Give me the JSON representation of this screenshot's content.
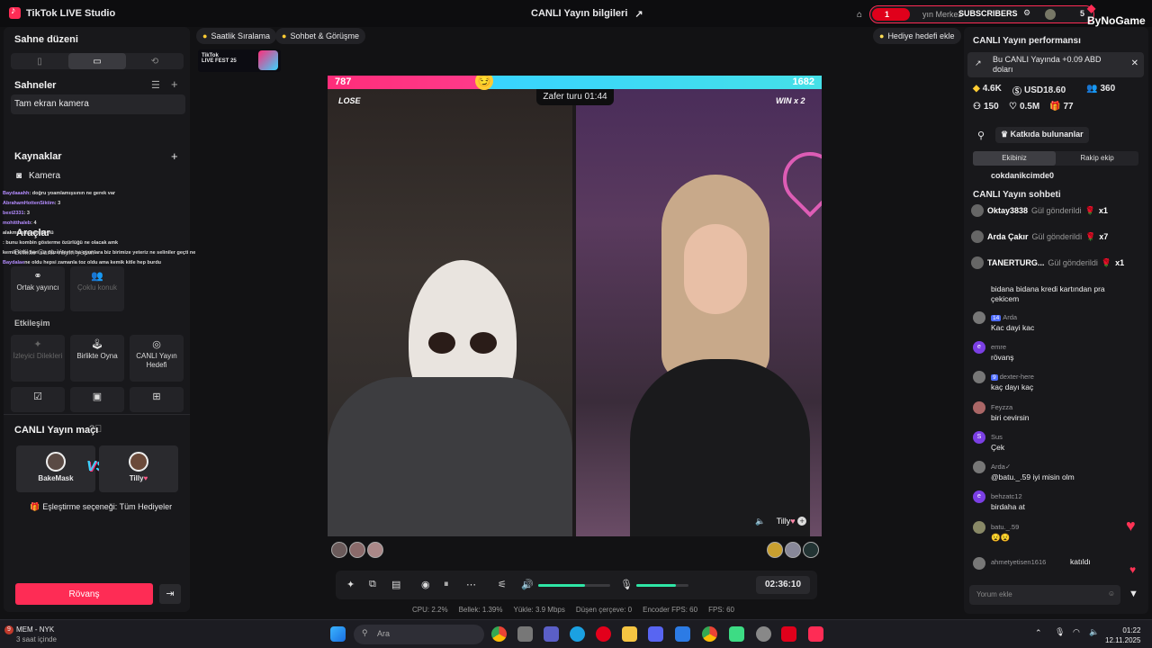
{
  "titlebar": {
    "app_name": "TikTok LIVE Studio",
    "live_info": "CANLI Yayın bilgileri",
    "sub_count_left": "1",
    "center_text": "yın Merkez",
    "subscribers": "SUBSCRIBERS",
    "sub_count_right": "5",
    "brand": "ByNoGame"
  },
  "left": {
    "scene_layout_title": "Sahne düzeni",
    "scenes_title": "Sahneler",
    "scene_item": "Tam ekran kamera",
    "sources_title": "Kaynaklar",
    "camera_label": "Kamera",
    "tools_title": "Araçlar",
    "tools_sub": "Birlikte Canlı Yayın yapın",
    "tiles": [
      {
        "label": "Ortak yayıncı"
      },
      {
        "label": "Çoklu konuk"
      }
    ],
    "interaction_title": "Etkileşim",
    "interaction_tiles": [
      {
        "label": "İzleyici Dilekleri"
      },
      {
        "label": "Birlikte Oyna"
      },
      {
        "label": "CANLI Yayın Hedefi"
      }
    ],
    "match_title": "CANLI Yayın maçı",
    "match_left": "BakeMask",
    "match_right": "Tilly",
    "match_vs": "VS",
    "pairing": "Eşleştirme seçeneği: Tüm Hediyeler",
    "rematch": "Rövanş"
  },
  "overlay_chat": [
    {
      "user": "Baydaaahh",
      "text": ": doğru yoamlamışsının ne gerek var"
    },
    {
      "user": "AbrahamHottenSiktim",
      "text": ": 3"
    },
    {
      "user": "bext2331",
      "text": ": 3"
    },
    {
      "user": "mohitthaleb",
      "text": ": 4"
    },
    {
      "user": "",
      "text": "alakmsın la sen köylü"
    },
    {
      "user": "",
      "text": ": bunu kombin gösterme özürlüğü ne olacak amk"
    },
    {
      "user": "",
      "text": "kemik kitle bari siz düzenleyin bu oyunlara biz birimize yeteriz ne seliniler geçti ne"
    },
    {
      "user": "Baydalae",
      "text": "ne oldu hepsi zamanla toz oldu ama kemik kitle hep burdu"
    }
  ],
  "center": {
    "chip_hourly": "Saatlik Sıralama",
    "chip_chat": "Sohbet & Görüşme",
    "chip_gift_goal": "Hediye hedefi ekle",
    "livefest_line1": "TikTok",
    "livefest_line2": "LIVE FEST 25",
    "score_left": "787",
    "score_right": "1682",
    "victory_timer": "Zafer turu 01:44",
    "lose_tag": "LOSE",
    "win_tag": "WIN x 2",
    "partner_name": "Tilly",
    "elapsed": "02:36:10",
    "mic_level": 0.75,
    "speaker_level": 0.65
  },
  "stats": {
    "cpu": "CPU:  2.2%",
    "memory": "Bellek:  1.39%",
    "upload": "Yükle:  3.9 Mbps",
    "dropped": "Düşen çerçeve:  0",
    "encoder_fps": "Encoder FPS:  60",
    "fps": "FPS:  60"
  },
  "right": {
    "perf_title": "CANLI Yayın performansı",
    "earn_line1": "Bu CANLI Yayında +0.09 ABD",
    "earn_line2": "doları",
    "m_diamonds": "4.6K",
    "m_usd": "USD18.60",
    "m_viewers": "360",
    "m_followers": "150",
    "m_likes": "0.5M",
    "m_gifts": "77",
    "contributors": "Katkıda bulunanlar",
    "tab_team": "Ekibiniz",
    "tab_rival": "Rakip ekip",
    "top_contrib": "cokdanikcimde0",
    "chat_title": "CANLI Yayın sohbeti",
    "gifts": [
      {
        "name": "Oktay3838",
        "verb": "Gül gönderildi",
        "count": "x1"
      },
      {
        "name": "Arda Çakır",
        "verb": "Gül gönderildi",
        "count": "x7"
      },
      {
        "name": "TANERTURG...",
        "verb": "Gül gönderildi",
        "count": "x1"
      }
    ],
    "comments": [
      {
        "user": "",
        "badge": "",
        "text": "bidana bidana kredi kartından pra"
      },
      {
        "user": "",
        "badge": "",
        "text": "çekicem"
      },
      {
        "user": "Arda",
        "badge": "14",
        "text": "Kac dayi kac"
      },
      {
        "user": "emre",
        "badge": "",
        "text": "rövanş"
      },
      {
        "user": "dexter-here",
        "badge": "9",
        "text": "kaç dayı kaç"
      },
      {
        "user": "Feyzza",
        "badge": "",
        "text": "biri cevirsin"
      },
      {
        "user": "Sus",
        "badge": "",
        "text": "Çek"
      },
      {
        "user": "Arda✓",
        "badge": "",
        "text": "@batu._.59 iyi misin olm"
      },
      {
        "user": "behzatc12",
        "badge": "",
        "text": "birdaha at"
      },
      {
        "user": "batu._.59",
        "badge": "",
        "text": "😧😧"
      },
      {
        "user": "ahmetyetisen1616",
        "badge": "",
        "text": "katıldı"
      }
    ],
    "comment_placeholder": "Yorum ekle"
  },
  "taskbar": {
    "news_title": "MEM - NYK",
    "news_sub": "3 saat içinde",
    "news_badge": "9",
    "search_placeholder": "Ara",
    "time": "01:22",
    "date": "12.11.2025"
  },
  "colors": {
    "accent": "#fe2c55",
    "teal": "#2ee6a6",
    "bar_left": "#ff2d7a",
    "bar_right": "#38d4ff"
  }
}
